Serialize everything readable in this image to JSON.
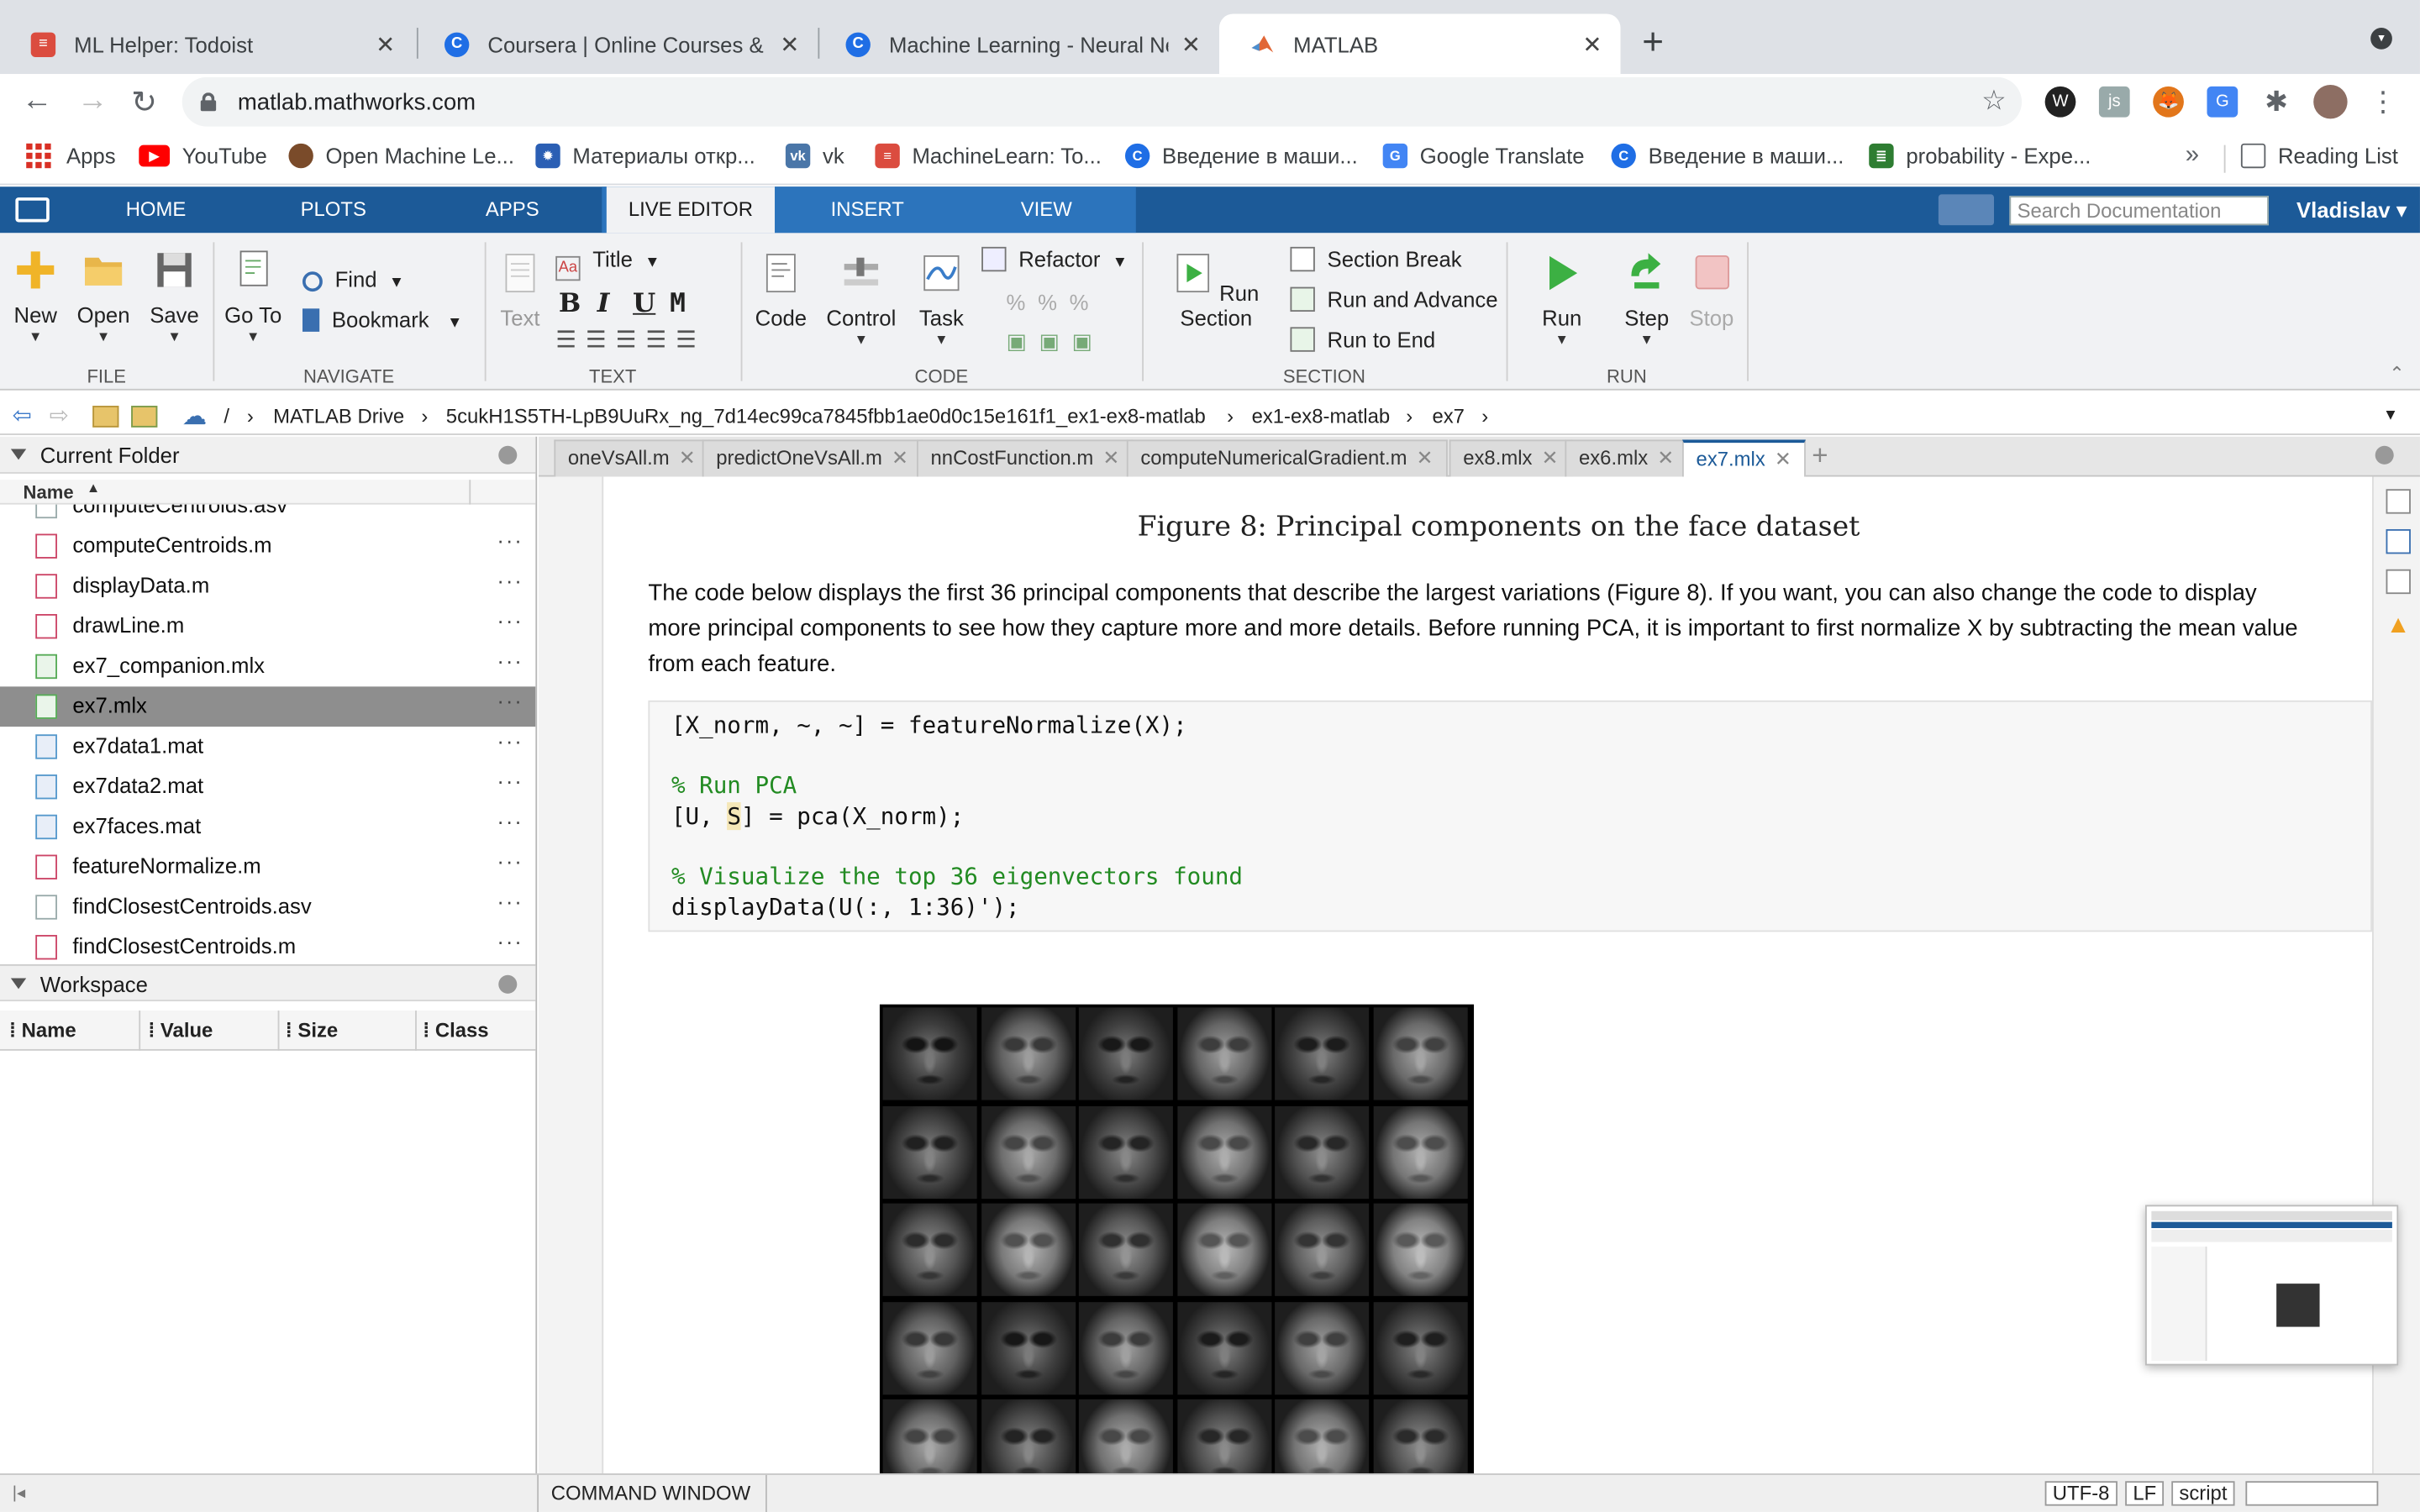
{
  "browser": {
    "tabs": [
      {
        "title": "ML Helper: Todoist",
        "icon": "todoist-icon",
        "color": "#db4c3f"
      },
      {
        "title": "Coursera | Online Courses & C",
        "icon": "coursera-icon",
        "color": "#1f6ee5"
      },
      {
        "title": "Machine Learning - Neural Net",
        "icon": "coursera-icon",
        "color": "#1f6ee5"
      },
      {
        "title": "MATLAB",
        "icon": "matlab-icon",
        "color": "#e16737"
      }
    ],
    "active_tab": 3,
    "url": "matlab.mathworks.com",
    "bookmarks": [
      {
        "label": "Apps"
      },
      {
        "label": "YouTube",
        "color": "#ff0000"
      },
      {
        "label": "Open Machine Le...",
        "color": "#7a4b2a"
      },
      {
        "label": "Материалы откр...",
        "color": "#2b5fb4"
      },
      {
        "label": "vk",
        "color": "#4a76a8"
      },
      {
        "label": "MachineLearn: To...",
        "color": "#db4c3f"
      },
      {
        "label": "Введение в маши...",
        "color": "#1f6ee5"
      },
      {
        "label": "Google Translate",
        "color": "#4285f4"
      },
      {
        "label": "Введение в маши...",
        "color": "#1f6ee5"
      },
      {
        "label": "probability - Expe...",
        "color": "#2e7d32"
      }
    ],
    "reading_list": "Reading List"
  },
  "matlab": {
    "tabs": [
      "HOME",
      "PLOTS",
      "APPS",
      "LIVE EDITOR",
      "INSERT",
      "VIEW"
    ],
    "search_placeholder": "Search Documentation",
    "user": "Vladislav",
    "ribbon": {
      "file": {
        "new": "New",
        "open": "Open",
        "save": "Save",
        "group": "FILE"
      },
      "navigate": {
        "goto": "Go To",
        "find": "Find",
        "bookmark": "Bookmark",
        "group": "NAVIGATE"
      },
      "text": {
        "text": "Text",
        "title": "Title",
        "bold": "B",
        "italic": "I",
        "underline": "U",
        "mono": "M",
        "group": "TEXT"
      },
      "code": {
        "code": "Code",
        "control": "Control",
        "task": "Task",
        "refactor": "Refactor",
        "group": "CODE"
      },
      "section": {
        "run_section": "Run Section",
        "section_break": "Section Break",
        "run_advance": "Run and Advance",
        "run_end": "Run to End",
        "group": "SECTION"
      },
      "run": {
        "run": "Run",
        "step": "Step",
        "stop": "Stop",
        "group": "RUN"
      }
    },
    "path": [
      "/",
      "MATLAB Drive",
      "5cukH1S5TH-LpB9UuRx_ng_7d14ec99ca7845fbb1ae0d0c15e161f1_ex1-ex8-matlab",
      "ex1-ex8-matlab",
      "ex7"
    ],
    "current_folder": {
      "title": "Current Folder",
      "column": "Name",
      "files": [
        {
          "name": "computeCentroids.asv",
          "type": "asv"
        },
        {
          "name": "computeCentroids.m",
          "type": "m"
        },
        {
          "name": "displayData.m",
          "type": "m"
        },
        {
          "name": "drawLine.m",
          "type": "m"
        },
        {
          "name": "ex7_companion.mlx",
          "type": "mlx"
        },
        {
          "name": "ex7.mlx",
          "type": "mlx",
          "selected": true
        },
        {
          "name": "ex7data1.mat",
          "type": "mat"
        },
        {
          "name": "ex7data2.mat",
          "type": "mat"
        },
        {
          "name": "ex7faces.mat",
          "type": "mat"
        },
        {
          "name": "featureNormalize.m",
          "type": "m"
        },
        {
          "name": "findClosestCentroids.asv",
          "type": "asv"
        },
        {
          "name": "findClosestCentroids.m",
          "type": "m"
        }
      ]
    },
    "workspace": {
      "title": "Workspace",
      "columns": [
        "Name",
        "Value",
        "Size",
        "Class"
      ]
    },
    "editor_tabs": [
      "oneVsAll.m",
      "predictOneVsAll.m",
      "nnCostFunction.m",
      "computeNumericalGradient.m",
      "ex8.mlx",
      "ex6.mlx",
      "ex7.mlx"
    ],
    "active_editor_tab": 6,
    "document": {
      "figure_caption": "Figure 8: Principal components on the face dataset",
      "paragraph": "The code below displays the first 36 principal components that describe the largest variations (Figure 8).  If you want, you can also change the code to display more principal components to see how they capture more and more details. Before running PCA, it is important to first normalize X by subtracting the mean value from each feature.",
      "code": {
        "line1": "[X_norm, ~, ~] = featureNormalize(X);",
        "line2": "% Run PCA",
        "line3a": "[U, ",
        "line3b": "S",
        "line3c": "] = pca(X_norm);",
        "line4": "% Visualize the top 36 eigenvectors found",
        "line5": "displayData(U(:, 1:36)');"
      }
    },
    "status": {
      "command_window": "COMMAND WINDOW",
      "encoding": "UTF-8",
      "line_ending": "LF",
      "mode": "script"
    }
  }
}
